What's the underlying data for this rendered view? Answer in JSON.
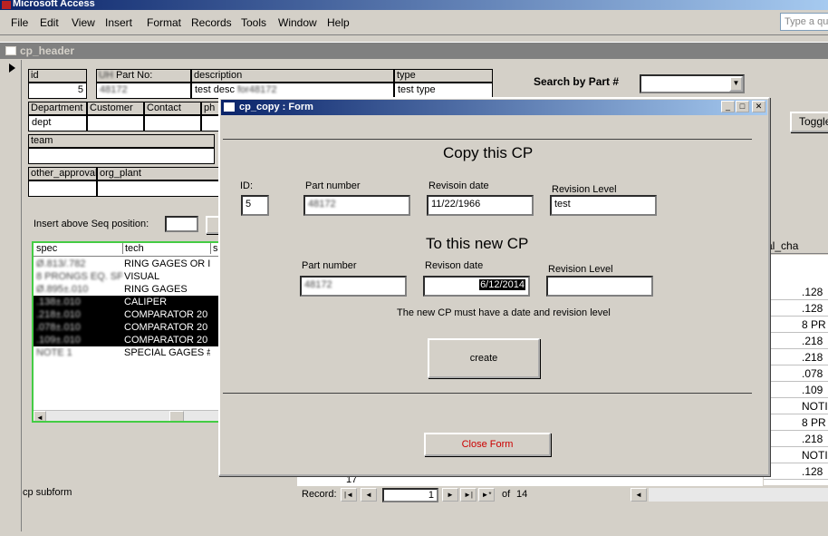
{
  "app": {
    "title": "Microsoft Access"
  },
  "menu": [
    "File",
    "Edit",
    "View",
    "Insert",
    "Format",
    "Records",
    "Tools",
    "Window",
    "Help"
  ],
  "help_box": {
    "placeholder": "Type a question for help"
  },
  "header_form": {
    "title": "cp_header",
    "labels": {
      "id": "id",
      "part_no": "Part No:",
      "description": "description",
      "type": "type",
      "department": "Department",
      "customer": "Customer",
      "contact": "Contact",
      "phone": "ph",
      "team": "team",
      "other_approval": "other_approval",
      "org_plant": "org_plant"
    },
    "values": {
      "id": "5",
      "part_no": "48172",
      "description_prefix": "test desc",
      "description_blur": "for48172",
      "type": "test type",
      "department": "dept"
    },
    "search_label": "Search by Part #",
    "insert_label": "Insert above Seq position:",
    "toggle_button": "Toggle",
    "subform_label": "cp subform",
    "right_col_header": "al_cha"
  },
  "subform": {
    "headers": [
      "spec",
      "tech",
      "si"
    ],
    "rows": [
      {
        "spec": "Ø.813/.782",
        "tech": "RING GAGES OR I",
        "sel": false
      },
      {
        "spec": "8 PRONGS EQ. SP",
        "tech": "VISUAL",
        "sel": false
      },
      {
        "spec": "Ø.895±.010",
        "tech": "RING GAGES",
        "sel": false
      },
      {
        "spec": ".138±.010",
        "tech": "CALIPER",
        "sel": true
      },
      {
        "spec": ".218±.010",
        "tech": "COMPARATOR 20",
        "sel": true
      },
      {
        "spec": ".078±.010",
        "tech": "COMPARATOR 20",
        "sel": true
      },
      {
        "spec": ".109±.010",
        "tech": "COMPARATOR 20",
        "sel": true
      },
      {
        "spec": "NOTE 1",
        "tech": "SPECIAL GAGES #",
        "sel": false
      }
    ]
  },
  "right_grid": [
    ".128",
    ".128",
    "8 PR",
    ".218",
    ".218",
    ".078",
    ".109",
    "NOTI",
    "8 PR",
    ".218",
    "NOTI",
    ".128"
  ],
  "dialog": {
    "title": "cp_copy : Form",
    "heading_copy": "Copy this CP",
    "heading_new": "To this new CP",
    "labels": {
      "id": "ID:",
      "part_number": "Part number",
      "revisoin_date": "Revisoin date",
      "revision_level": "Revision Level",
      "revison_date": "Revison date"
    },
    "copy": {
      "id": "5",
      "part_number": "48172",
      "date": "11/22/1966",
      "level": "test"
    },
    "new": {
      "part_number": "48172",
      "date": "6/12/2014",
      "level": ""
    },
    "note": "The new CP must have a date and revision level",
    "create_button": "create",
    "close_button": "Close Form"
  },
  "navigation": {
    "record_label": "Record:",
    "current": "1",
    "of_label": "of",
    "total": "14",
    "partial_row": "17"
  },
  "colors": {
    "title_blue": "#0a246a",
    "close_red": "#cc0000",
    "subform_border": "#44cc44"
  }
}
